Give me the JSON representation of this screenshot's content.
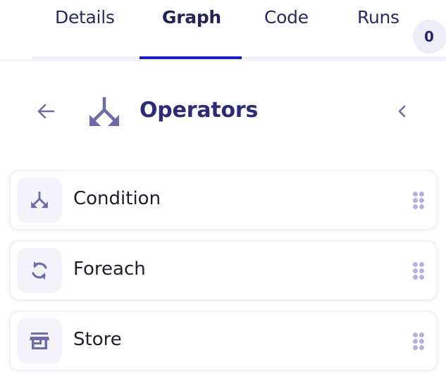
{
  "tabs": [
    {
      "label": "Details",
      "active": false
    },
    {
      "label": "Graph",
      "active": true
    },
    {
      "label": "Code",
      "active": false
    },
    {
      "label": "Runs",
      "active": false,
      "badge": "0"
    }
  ],
  "header": {
    "title": "Operators",
    "back_icon": "arrow-left-icon",
    "title_icon": "split-arrows-icon",
    "collapse_icon": "chevron-left-icon"
  },
  "operators": [
    {
      "label": "Condition",
      "icon": "split-arrows-icon"
    },
    {
      "label": "Foreach",
      "icon": "loop-arrows-icon"
    },
    {
      "label": "Store",
      "icon": "storefront-icon"
    }
  ],
  "colors": {
    "accent": "#1c1ac8",
    "title": "#2b2b7c",
    "icon": "#6e6ca8",
    "icon_bg": "#f4f3fa",
    "drag_dots": "#b3b1df",
    "badge_bg": "#ededf7"
  }
}
